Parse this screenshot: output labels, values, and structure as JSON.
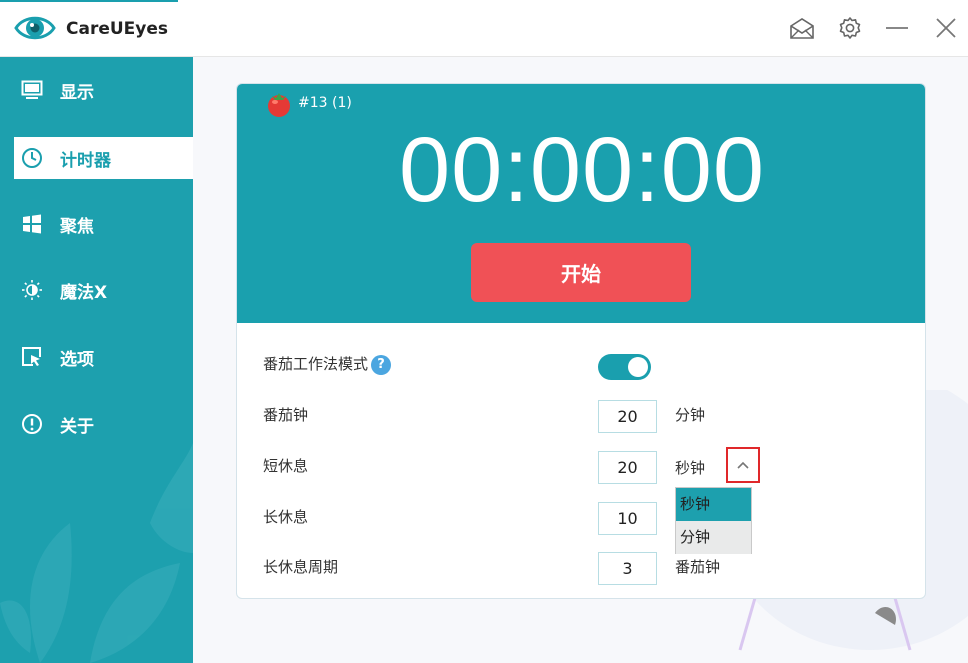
{
  "window": {
    "title": "CareUEyes"
  },
  "titlebar": {
    "buttons": [
      {
        "name": "mail-button",
        "icon": "mail-icon"
      },
      {
        "name": "settings-button",
        "icon": "gear-icon"
      },
      {
        "name": "minimize-button",
        "icon": "minimize-icon"
      },
      {
        "name": "close-button",
        "icon": "close-icon"
      }
    ]
  },
  "sidebar": {
    "items": [
      {
        "label": "显示",
        "icon": "monitor-icon",
        "active": false
      },
      {
        "label": "计时器",
        "icon": "clock-icon",
        "active": true
      },
      {
        "label": "聚焦",
        "icon": "windows-icon",
        "active": false
      },
      {
        "label": "魔法X",
        "icon": "sun-icon",
        "active": false
      },
      {
        "label": "选项",
        "icon": "cursor-window-icon",
        "active": false
      },
      {
        "label": "关于",
        "icon": "info-icon",
        "active": false
      }
    ]
  },
  "timer": {
    "pomodoro_counter": "#13 (1)",
    "display": "00:00:00",
    "start_label": "开始"
  },
  "settings": {
    "pomodoro_mode_label": "番茄工作法模式",
    "help_glyph": "?",
    "pomodoro_mode_enabled": true,
    "rows": [
      {
        "label": "番茄钟",
        "value": "20",
        "unit": "分钟"
      },
      {
        "label": "短休息",
        "value": "20",
        "unit": "秒钟"
      },
      {
        "label": "长休息",
        "value": "10",
        "unit": ""
      },
      {
        "label": "长休息周期",
        "value": "3",
        "unit": "番茄钟"
      }
    ]
  },
  "dropdown": {
    "options": [
      "秒钟",
      "分钟"
    ],
    "selected": "秒钟"
  },
  "colors": {
    "accent": "#1da0ae",
    "start_button": "#f05156",
    "highlight_border": "#e0282a"
  }
}
